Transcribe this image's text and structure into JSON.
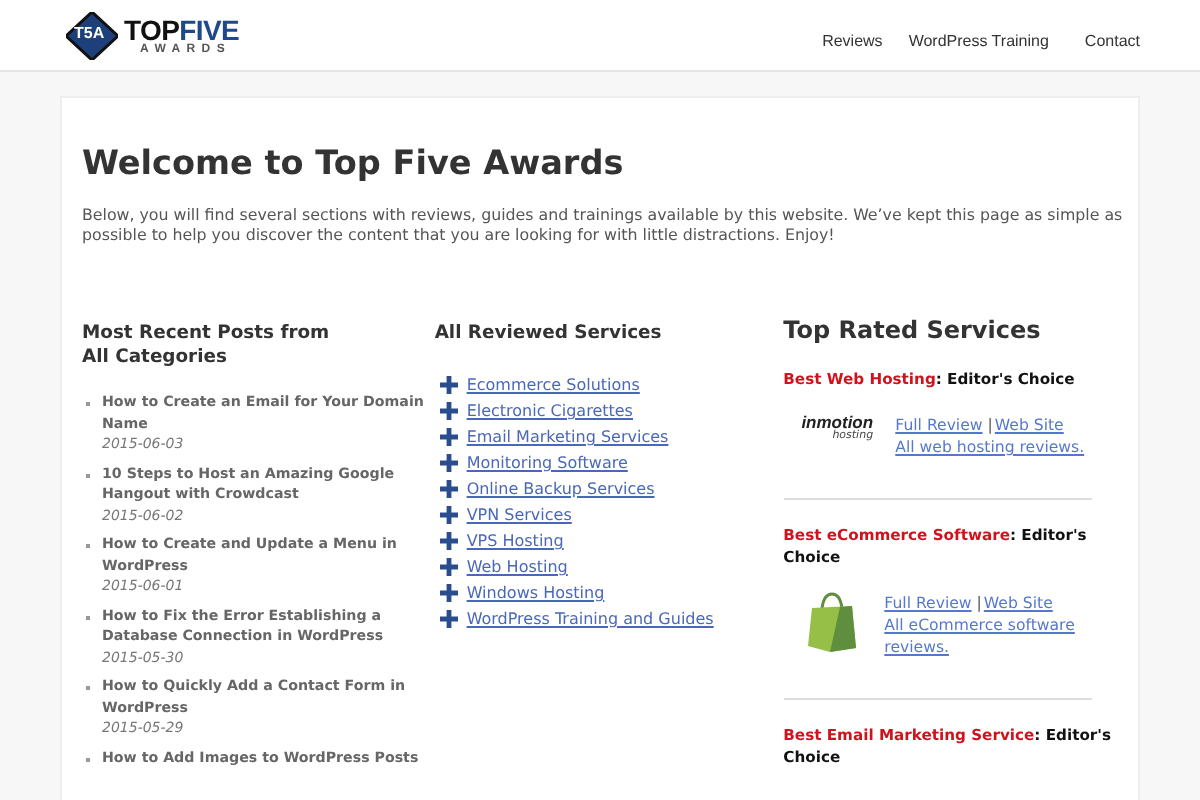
{
  "logo": {
    "badge": "T5A",
    "word_a": "TOP",
    "word_b": "FIVE",
    "subtitle": "AWARDS"
  },
  "nav": [
    "Reviews",
    "WordPress Training",
    "Contact"
  ],
  "title": "Welcome to Top Five Awards",
  "intro": "Below, you will find several sections with reviews, guides and trainings available by this website. We’ve kept this page as simple as possible to help you discover the content that you are looking for with little distractions. Enjoy!",
  "recent_posts": {
    "heading": "Most Recent Posts from All Categories",
    "items": [
      {
        "title": "How to Create an Email for Your Domain Name",
        "date": "2015-06-03"
      },
      {
        "title": "10 Steps to Host an Amazing Google Hangout with Crowdcast",
        "date": "2015-06-02"
      },
      {
        "title": "How to Create and Update a Menu in WordPress",
        "date": "2015-06-01"
      },
      {
        "title": "How to Fix the Error Establishing a Database Connection in WordPress",
        "date": "2015-05-30"
      },
      {
        "title": "How to Quickly Add a Contact Form in WordPress",
        "date": "2015-05-29"
      },
      {
        "title": "How to Add Images to WordPress Posts"
      }
    ]
  },
  "services": {
    "heading": "All Reviewed Services",
    "items": [
      "Ecommerce Solutions",
      "Electronic Cigarettes",
      "Email Marketing Services",
      "Monitoring Software",
      "Online Backup Services",
      "VPN Services",
      "VPS Hosting",
      "Web Hosting",
      "Windows Hosting",
      "WordPress Training and Guides"
    ]
  },
  "top_rated": {
    "heading": "Top Rated Services",
    "items": [
      {
        "category": "Best Web Hosting",
        "suffix": ": Editor's Choice",
        "kind": "wordmark",
        "logo_text": "inmotion",
        "logo_subtext": "hosting",
        "review": "Full Review",
        "sep": "|",
        "site": "Web Site",
        "all": "All web hosting reviews."
      },
      {
        "category": "Best eCommerce Software",
        "suffix": ": Editor's Choice",
        "kind": "bag",
        "review": "Full Review",
        "sep": "|",
        "site": "Web Site",
        "all": "All eCommerce software reviews."
      },
      {
        "category": "Best Email Marketing Service",
        "suffix": ": Editor's Choice"
      }
    ]
  }
}
